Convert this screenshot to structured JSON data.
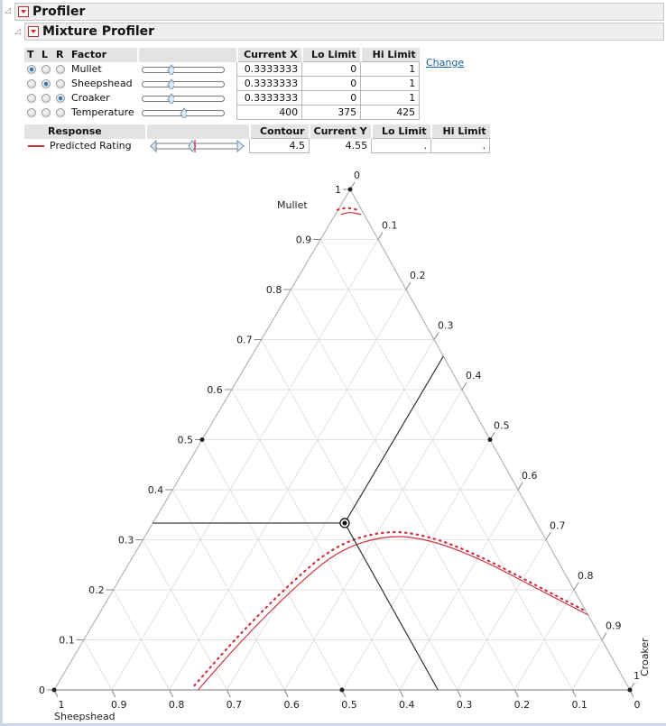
{
  "outline": {
    "profiler_title": "Profiler",
    "mixture_title": "Mixture Profiler"
  },
  "factor_table": {
    "headers": {
      "t": "T",
      "l": "L",
      "r": "R",
      "factor": "Factor",
      "current_x": "Current X",
      "lo_limit": "Lo Limit",
      "hi_limit": "Hi Limit"
    },
    "rows": [
      {
        "name": "Mullet",
        "t": true,
        "l": false,
        "r": false,
        "current_x": "0.3333333",
        "lo_limit": "0",
        "hi_limit": "1",
        "slider_fraction": 0.3333
      },
      {
        "name": "Sheepshead",
        "t": false,
        "l": true,
        "r": false,
        "current_x": "0.3333333",
        "lo_limit": "0",
        "hi_limit": "1",
        "slider_fraction": 0.3333
      },
      {
        "name": "Croaker",
        "t": false,
        "l": false,
        "r": true,
        "current_x": "0.3333333",
        "lo_limit": "0",
        "hi_limit": "1",
        "slider_fraction": 0.3333
      },
      {
        "name": "Temperature",
        "t": false,
        "l": false,
        "r": false,
        "current_x": "400",
        "lo_limit": "375",
        "hi_limit": "425",
        "slider_fraction": 0.5
      }
    ],
    "change_link": "Change"
  },
  "response_table": {
    "headers": {
      "response": "Response",
      "contour": "Contour",
      "current_y": "Current Y",
      "lo_limit": "Lo Limit",
      "hi_limit": "Hi Limit"
    },
    "rows": [
      {
        "name": "Predicted Rating",
        "contour": "4.5",
        "current_y": "4.55",
        "lo_limit": ".",
        "hi_limit": ".",
        "color": "#cc3340"
      }
    ]
  },
  "chart_data": {
    "type": "ternary",
    "axes": {
      "top": {
        "label": "Mullet",
        "ticks": [
          "0",
          "0.1",
          "0.2",
          "0.3",
          "0.4",
          "0.5",
          "0.6",
          "0.7",
          "0.8",
          "0.9",
          "1"
        ]
      },
      "left": {
        "label": "Sheepshead",
        "ticks": [
          "0",
          "0.1",
          "0.2",
          "0.3",
          "0.4",
          "0.5",
          "0.6",
          "0.7",
          "0.8",
          "0.9",
          "1"
        ]
      },
      "right": {
        "label": "Croaker",
        "ticks": [
          "0",
          "0.1",
          "0.2",
          "0.3",
          "0.4",
          "0.5",
          "0.6",
          "0.7",
          "0.8",
          "0.9",
          "1"
        ]
      }
    },
    "grid": true,
    "gridlines_step": 0.1,
    "current_point": {
      "mullet": 0.3333,
      "sheepshead": 0.3333,
      "croaker": 0.3333
    },
    "design_points": [
      {
        "mullet": 1,
        "sheepshead": 0,
        "croaker": 0
      },
      {
        "mullet": 0,
        "sheepshead": 1,
        "croaker": 0
      },
      {
        "mullet": 0,
        "sheepshead": 0,
        "croaker": 1
      },
      {
        "mullet": 0.5,
        "sheepshead": 0.5,
        "croaker": 0
      },
      {
        "mullet": 0.5,
        "sheepshead": 0,
        "croaker": 0.5
      },
      {
        "mullet": 0,
        "sheepshead": 0.5,
        "croaker": 0.5
      },
      {
        "mullet": 0.3333,
        "sheepshead": 0.3333,
        "croaker": 0.3333
      }
    ],
    "contours": [
      {
        "name": "Predicted Rating = 4.5",
        "color": "#cc3340",
        "segments": [
          [
            {
              "mullet": 0.95,
              "sheepshead": 0.04,
              "croaker": 0.01
            },
            {
              "mullet": 0.955,
              "sheepshead": 0.022,
              "croaker": 0.023
            },
            {
              "mullet": 0.95,
              "sheepshead": 0.005,
              "croaker": 0.045
            }
          ],
          [
            {
              "mullet": 0,
              "sheepshead": 0.75,
              "croaker": 0.25
            },
            {
              "mullet": 0.1,
              "sheepshead": 0.625,
              "croaker": 0.275
            },
            {
              "mullet": 0.2,
              "sheepshead": 0.49,
              "croaker": 0.31
            },
            {
              "mullet": 0.28,
              "sheepshead": 0.37,
              "croaker": 0.35
            },
            {
              "mullet": 0.31,
              "sheepshead": 0.27,
              "croaker": 0.42
            },
            {
              "mullet": 0.3,
              "sheepshead": 0.2,
              "croaker": 0.5
            },
            {
              "mullet": 0.26,
              "sheepshead": 0.13,
              "croaker": 0.61
            },
            {
              "mullet": 0.2,
              "sheepshead": 0.06,
              "croaker": 0.74
            },
            {
              "mullet": 0.15,
              "sheepshead": 0,
              "croaker": 0.85
            }
          ]
        ]
      }
    ],
    "crosshair_from": {
      "mullet": 0.3333,
      "sheepshead": 0.3333,
      "croaker": 0.3333
    }
  }
}
